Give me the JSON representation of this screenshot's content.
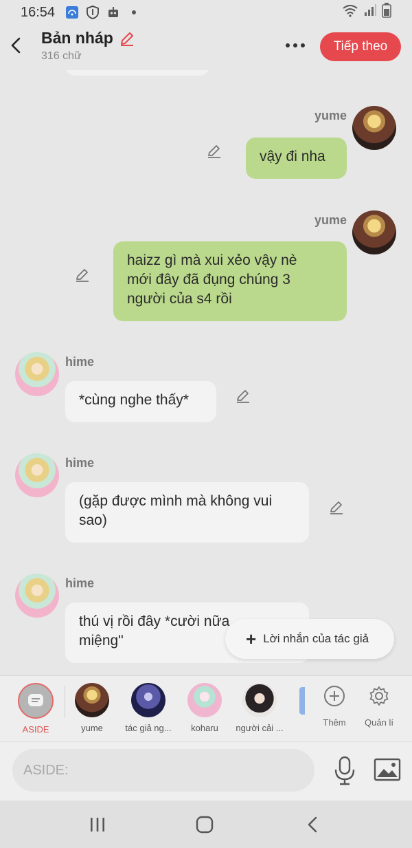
{
  "status_bar": {
    "time": "16:54",
    "icons": [
      "wifi-calling-icon",
      "shield-icon",
      "robot-icon",
      "dot-icon",
      "wifi-icon",
      "signal-icon",
      "battery-icon"
    ]
  },
  "header": {
    "title": "Bản nháp",
    "word_count": "316 chữ",
    "next_label": "Tiếp theo",
    "accent": "#e5484d"
  },
  "messages": [
    {
      "sender": "yume",
      "side": "right",
      "text": "vậy đi nha"
    },
    {
      "sender": "yume",
      "side": "right",
      "text": "haizz gì mà xui xẻo vậy nè\nmới đây đã đụng chúng 3\nngười của s4 rồi"
    },
    {
      "sender": "hime",
      "side": "left",
      "text": "*cùng nghe thấy*"
    },
    {
      "sender": "hime",
      "side": "left",
      "text": "(gặp được mình mà không vui\nsao)"
    },
    {
      "sender": "hime",
      "side": "left",
      "text": "thú vị rồi đây *cười nữa\nmiệng\""
    }
  ],
  "author_note": {
    "label": "Lời nhắn của tác giả"
  },
  "characters": {
    "aside_label": "ASIDE",
    "items": [
      "yume",
      "tác giả ng...",
      "koharu",
      "người cải ..."
    ],
    "add_label": "Thêm",
    "manage_label": "Quản lí"
  },
  "input": {
    "placeholder": "ASIDE:"
  },
  "colors": {
    "me_bubble": "#bad98c",
    "other_bubble": "#f3f3f3",
    "background": "#e7e7e7"
  }
}
